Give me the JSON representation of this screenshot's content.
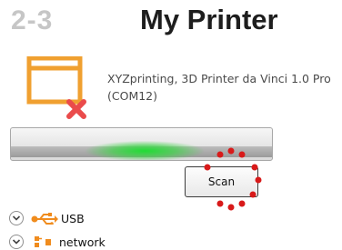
{
  "header": {
    "step_number": "2-3",
    "title": "My Printer"
  },
  "printer": {
    "name_line1": "XYZprinting, 3D Printer da Vinci 1.0 Pro",
    "name_line2": "(COM12)",
    "status": "disconnected",
    "icon": "printer-disconnected-icon"
  },
  "scan": {
    "progress_label": "",
    "button_label": "Scan"
  },
  "connections": [
    {
      "label": "USB",
      "icon": "usb-icon",
      "expander_icon": "chevron-down-icon"
    },
    {
      "label": "network",
      "icon": "network-icon",
      "expander_icon": "chevron-down-icon"
    }
  ],
  "colors": {
    "printer_icon": "#f0a030",
    "error_x": "#ea4b4b",
    "progress_glow": "#22dd33",
    "highlight_dots": "#d81a1a",
    "usb_icon": "#f08c1e",
    "step_number": "#c6c6c6"
  }
}
